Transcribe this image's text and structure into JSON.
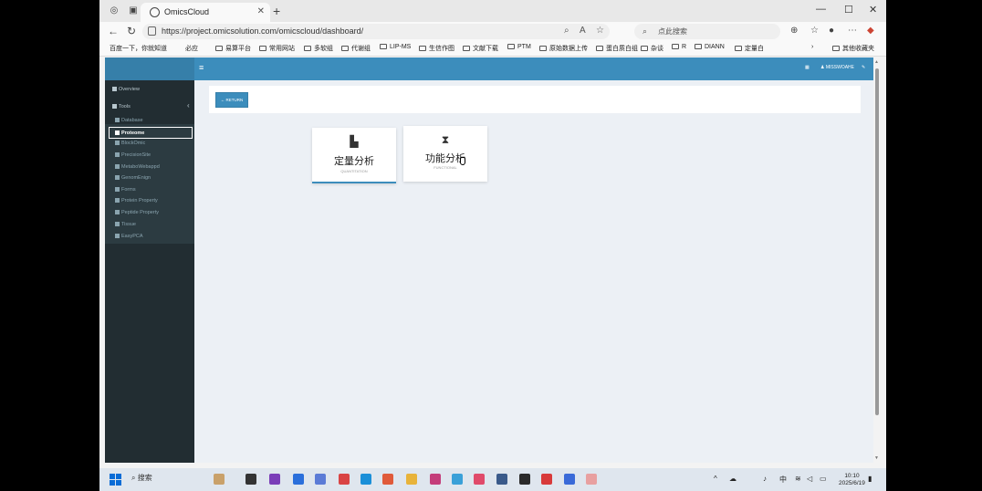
{
  "browser": {
    "tab_title": "OmicsCloud",
    "url": "https://project.omicsolution.com/omicscloud/dashboard/",
    "search_placeholder": "点此搜索",
    "bookmarks": [
      "百度一下，你就知道",
      "必应",
      "易算平台",
      "常用网站",
      "多软组",
      "代谢组",
      "LIP-MS",
      "生信作图",
      "文献下载",
      "PTM",
      "原始数据上传",
      "蛋白质白组",
      "杂谈",
      "R",
      "DIANN",
      "定量白"
    ],
    "other_bookmarks": "其他收藏夹"
  },
  "app": {
    "header_user": "MISSWOAHE",
    "sidebar": {
      "overview": "Overview",
      "tools": "Tools",
      "items": [
        "Database",
        "Proteome",
        "BlockOmic",
        "PrecisionSite",
        "MetaboWebappd",
        "GenomEnign",
        "Forms",
        "Protein Property",
        "Peptide Property",
        "Tissue",
        "EasyPCA"
      ],
      "active": "Proteome"
    },
    "return_button": "← RETURN",
    "cards": [
      {
        "title": "定量分析",
        "subtitle": "QUANTITATION",
        "icon": "bar-chart-icon"
      },
      {
        "title": "功能分析",
        "subtitle": "FUNCTIONAL",
        "icon": "hourglass-icon"
      }
    ]
  },
  "taskbar": {
    "search": "搜索",
    "ime": "中",
    "time": "10:10",
    "date": "2025/6/19"
  }
}
